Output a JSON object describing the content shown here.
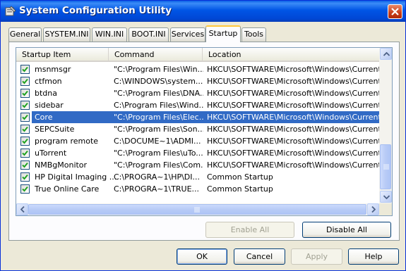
{
  "window": {
    "title": "System Configuration Utility",
    "icon": "msconfig-icon"
  },
  "tabs": [
    {
      "label": "General",
      "active": false
    },
    {
      "label": "SYSTEM.INI",
      "active": false
    },
    {
      "label": "WIN.INI",
      "active": false
    },
    {
      "label": "BOOT.INI",
      "active": false
    },
    {
      "label": "Services",
      "active": false
    },
    {
      "label": "Startup",
      "active": true
    },
    {
      "label": "Tools",
      "active": false
    }
  ],
  "list": {
    "columns": [
      "Startup Item",
      "Command",
      "Location"
    ],
    "rows": [
      {
        "item": "msnmsgr",
        "command": "\"C:\\Program Files\\Win...",
        "location": "HKCU\\SOFTWARE\\Microsoft\\Windows\\CurrentVer...",
        "checked": true,
        "selected": false
      },
      {
        "item": "ctfmon",
        "command": "C:\\WINDOWS\\system...",
        "location": "HKCU\\SOFTWARE\\Microsoft\\Windows\\CurrentVer...",
        "checked": true,
        "selected": false
      },
      {
        "item": "btdna",
        "command": "\"C:\\Program Files\\DNA...",
        "location": "HKCU\\SOFTWARE\\Microsoft\\Windows\\CurrentVer...",
        "checked": true,
        "selected": false
      },
      {
        "item": "sidebar",
        "command": "C:\\Program Files\\Wind...",
        "location": "HKCU\\SOFTWARE\\Microsoft\\Windows\\CurrentVer...",
        "checked": true,
        "selected": false
      },
      {
        "item": "Core",
        "command": "\"C:\\Program Files\\Elec...",
        "location": "HKCU\\SOFTWARE\\Microsoft\\Windows\\CurrentVer...",
        "checked": true,
        "selected": true
      },
      {
        "item": "SEPCSuite",
        "command": "\"C:\\Program Files\\Son...",
        "location": "HKCU\\SOFTWARE\\Microsoft\\Windows\\CurrentVer...",
        "checked": true,
        "selected": false
      },
      {
        "item": "program remote",
        "command": "C:\\DOCUME~1\\ADMI...",
        "location": "HKCU\\SOFTWARE\\Microsoft\\Windows\\CurrentVer...",
        "checked": true,
        "selected": false
      },
      {
        "item": "uTorrent",
        "command": "\"C:\\Program Files\\uTo...",
        "location": "HKCU\\SOFTWARE\\Microsoft\\Windows\\CurrentVer...",
        "checked": true,
        "selected": false
      },
      {
        "item": "NMBgMonitor",
        "command": "\"C:\\Program Files\\Com...",
        "location": "HKCU\\SOFTWARE\\Microsoft\\Windows\\CurrentVer...",
        "checked": true,
        "selected": false
      },
      {
        "item": "HP Digital Imaging ...",
        "command": "C:\\PROGRA~1\\HP\\DI...",
        "location": "Common Startup",
        "checked": true,
        "selected": false
      },
      {
        "item": "True Online Care",
        "command": "C:\\PROGRA~1\\TRUE...",
        "location": "Common Startup",
        "checked": true,
        "selected": false
      }
    ]
  },
  "buttons": {
    "enable_all": "Enable All",
    "disable_all": "Disable All",
    "ok": "OK",
    "cancel": "Cancel",
    "apply": "Apply",
    "help": "Help"
  },
  "colors": {
    "selection": "#316ac5",
    "titlebar": "#0055e5",
    "active_tab_accent": "#ffc83c"
  }
}
